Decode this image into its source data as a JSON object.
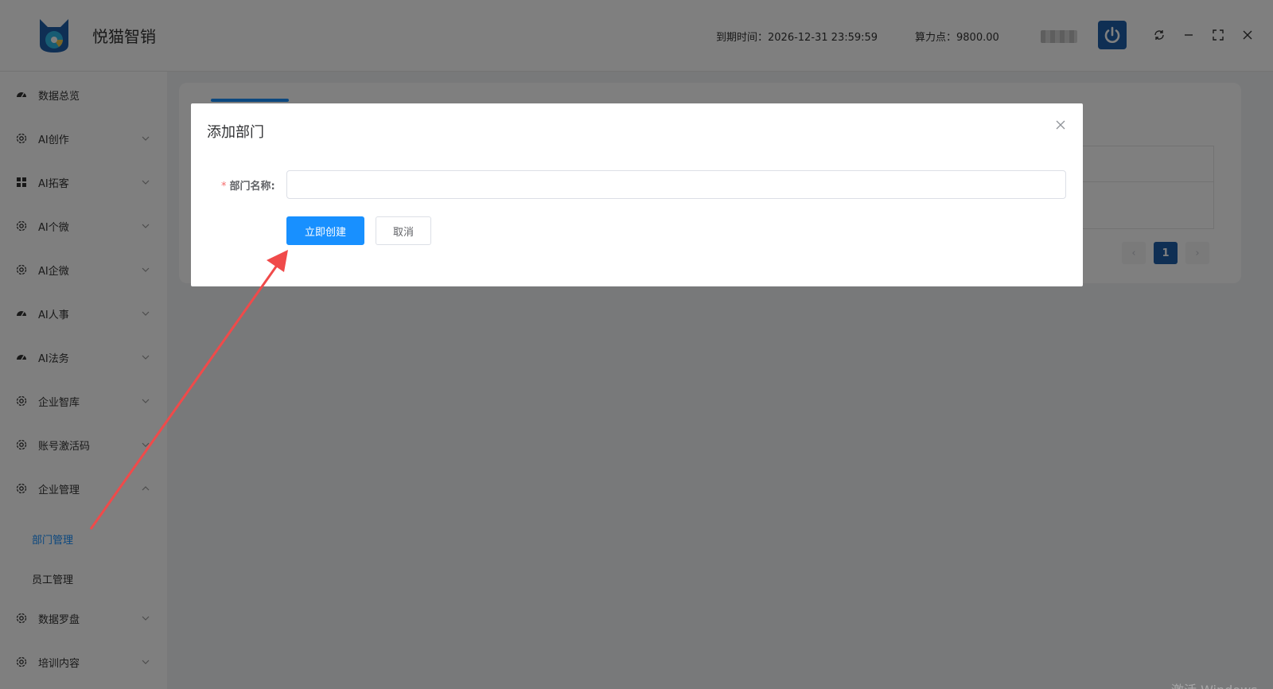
{
  "header": {
    "app_title": "悦猫智销",
    "expire_text": "到期时间：2026-12-31 23:59:59",
    "compute_text": "算力点：9800.00",
    "brand_color": "#1f5fa8"
  },
  "sidebar": {
    "items": [
      {
        "label": "数据总览",
        "icon": "dashboard-icon"
      },
      {
        "label": "AI创作",
        "icon": "gear-icon"
      },
      {
        "label": "AI拓客",
        "icon": "grid-icon"
      },
      {
        "label": "AI个微",
        "icon": "gear-icon"
      },
      {
        "label": "AI企微",
        "icon": "gear-icon"
      },
      {
        "label": "AI人事",
        "icon": "dashboard-icon"
      },
      {
        "label": "AI法务",
        "icon": "dashboard-icon"
      },
      {
        "label": "企业智库",
        "icon": "gear-icon"
      },
      {
        "label": "账号激活码",
        "icon": "gear-icon"
      },
      {
        "label": "企业管理",
        "icon": "gear-icon"
      },
      {
        "label": "数据罗盘",
        "icon": "gear-icon"
      },
      {
        "label": "培训内容",
        "icon": "gear-icon"
      }
    ],
    "sub_items": [
      {
        "label": "部门管理",
        "active": true
      },
      {
        "label": "员工管理",
        "active": false
      }
    ]
  },
  "pagination": {
    "prev": "‹",
    "current": "1",
    "next": "›"
  },
  "dialog": {
    "title": "添加部门",
    "required_mark": "*",
    "field_label": "部门名称:",
    "field_value": "",
    "field_placeholder": "",
    "create_button": "立即创建",
    "cancel_button": "取消",
    "primary_color": "#1890ff"
  },
  "watermark": "激活 Windows"
}
